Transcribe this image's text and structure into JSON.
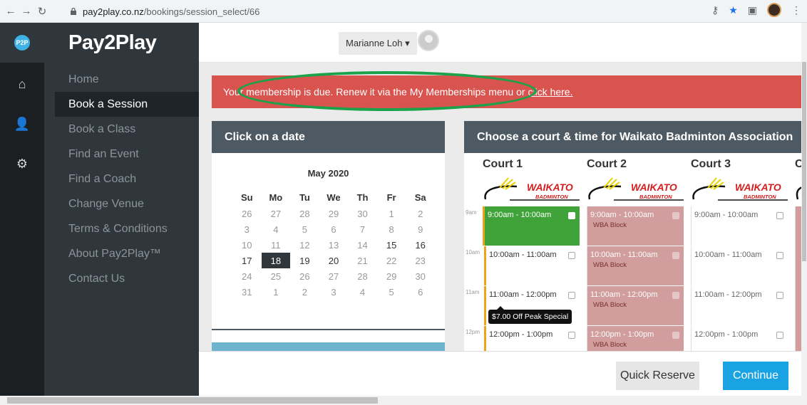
{
  "browser": {
    "url_host": "pay2play.co.nz",
    "url_path": "/bookings/session_select/66"
  },
  "iconbar": {
    "logo_text": "P2P"
  },
  "sidebar": {
    "brand": "Pay2Play",
    "items": [
      {
        "label": "Home"
      },
      {
        "label": "Book a Session"
      },
      {
        "label": "Book a Class"
      },
      {
        "label": "Find an Event"
      },
      {
        "label": "Find a Coach"
      },
      {
        "label": "Change Venue"
      },
      {
        "label": "Terms & Conditions"
      },
      {
        "label": "About Pay2Play™"
      },
      {
        "label": "Contact Us"
      }
    ]
  },
  "topbar": {
    "user_name": "Marianne Loh"
  },
  "alert": {
    "text": "Your membership is due. Renew it via the My Memberships menu or ",
    "link": "click here."
  },
  "calendar": {
    "header": "Click on a date",
    "month": "May 2020",
    "weekdays": [
      "Su",
      "Mo",
      "Tu",
      "We",
      "Th",
      "Fr",
      "Sa"
    ],
    "rows": [
      [
        "26",
        "27",
        "28",
        "29",
        "30",
        "1",
        "2"
      ],
      [
        "3",
        "4",
        "5",
        "6",
        "7",
        "8",
        "9"
      ],
      [
        "10",
        "11",
        "12",
        "13",
        "14",
        "15",
        "16"
      ],
      [
        "17",
        "18",
        "19",
        "20",
        "21",
        "22",
        "23"
      ],
      [
        "24",
        "25",
        "26",
        "27",
        "28",
        "29",
        "30"
      ],
      [
        "31",
        "1",
        "2",
        "3",
        "4",
        "5",
        "6"
      ]
    ],
    "selected": "18"
  },
  "courts": {
    "header": "Choose a court & time for Waikato Badminton Association",
    "names": [
      "Court 1",
      "Court 2",
      "Court 3",
      "C"
    ],
    "logo_text": "WAIKATO",
    "logo_sub": "BADMINTON",
    "hours": [
      "9am",
      "10am",
      "11am",
      "12pm"
    ],
    "court1": [
      "9:00am - 10:00am",
      "10:00am - 11:00am",
      "11:00am - 12:00pm",
      "12:00pm - 1:00pm"
    ],
    "court2": [
      "9:00am - 10:00am",
      "10:00am - 11:00am",
      "11:00am - 12:00pm",
      "12:00pm - 1:00pm"
    ],
    "court2_note": "WBA Block",
    "court3": [
      "9:00am - 10:00am",
      "10:00am - 11:00am",
      "11:00am - 12:00pm",
      "12:00pm - 1:00pm"
    ],
    "tooltip": "$7.00 Off Peak Special"
  },
  "footer": {
    "quick_reserve": "Quick Reserve",
    "continue": "Continue"
  },
  "colors": {
    "alert": "#d9534f",
    "selected_slot": "#3fa33a",
    "blocked_slot": "#d19d9d",
    "continue": "#1aa3e3",
    "sidebar": "#2f373d"
  }
}
